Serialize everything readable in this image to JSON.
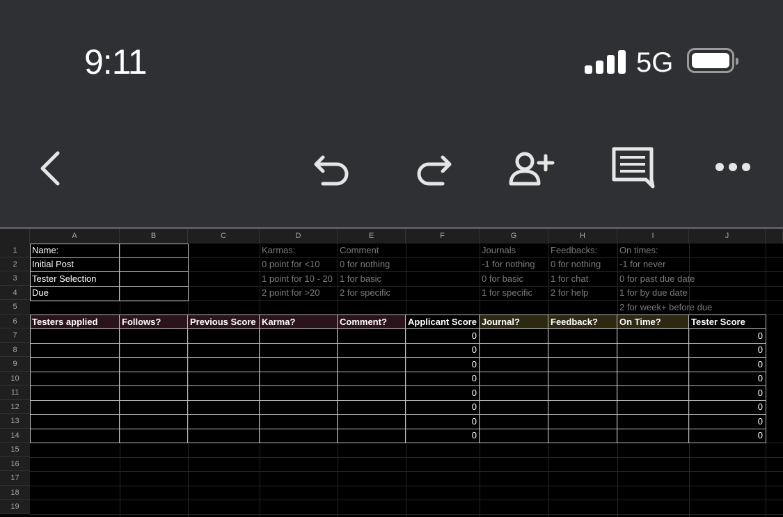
{
  "status": {
    "time": "9:11",
    "network": "5G"
  },
  "toolbar": {
    "icons": [
      "back-icon",
      "undo-icon",
      "redo-icon",
      "share-icon",
      "comment-icon",
      "more-icon"
    ]
  },
  "colors": {
    "chrome": "#2f3033",
    "header_pink": "#2a131a",
    "header_yellow": "#2d2812"
  },
  "columns": [
    "A",
    "B",
    "C",
    "D",
    "E",
    "F",
    "G",
    "H",
    "I",
    "J"
  ],
  "rows": [
    "1",
    "2",
    "3",
    "4",
    "5",
    "6",
    "7",
    "8",
    "9",
    "10",
    "11",
    "12",
    "13",
    "14",
    "15",
    "16",
    "17",
    "18",
    "19"
  ],
  "legend": {
    "name_label": "Name:",
    "initial_post": "Initial Post",
    "tester_selection": "Tester Selection",
    "due": "Due",
    "karmas": [
      "Karmas:",
      "0 point for <10",
      "1 point for 10 - 20",
      "2 point for >20"
    ],
    "comment": [
      "Comment",
      "0 for nothing",
      "1 for basic",
      "2 for specific"
    ],
    "journals": [
      "Journals",
      "-1 for nothing",
      "0 for basic",
      "1 for specific"
    ],
    "feedbacks": [
      "Feedbacks:",
      "0 for nothing",
      "1 for chat",
      "2 for help"
    ],
    "on_times": [
      "On times:",
      "-1 for never",
      "0 for past due date",
      "1 for by due date",
      "2 for week+ before due"
    ]
  },
  "table_headers": [
    "Testers applied",
    "Follows?",
    "Previous Score",
    "Karma?",
    "Comment?",
    "Applicant Score",
    "Journal?",
    "Feedback?",
    "On Time?",
    "Tester Score"
  ],
  "applicant_scores": [
    "0",
    "0",
    "0",
    "0",
    "0",
    "0",
    "0",
    "0"
  ],
  "tester_scores": [
    "0",
    "0",
    "0",
    "0",
    "0",
    "0",
    "0",
    "0"
  ]
}
